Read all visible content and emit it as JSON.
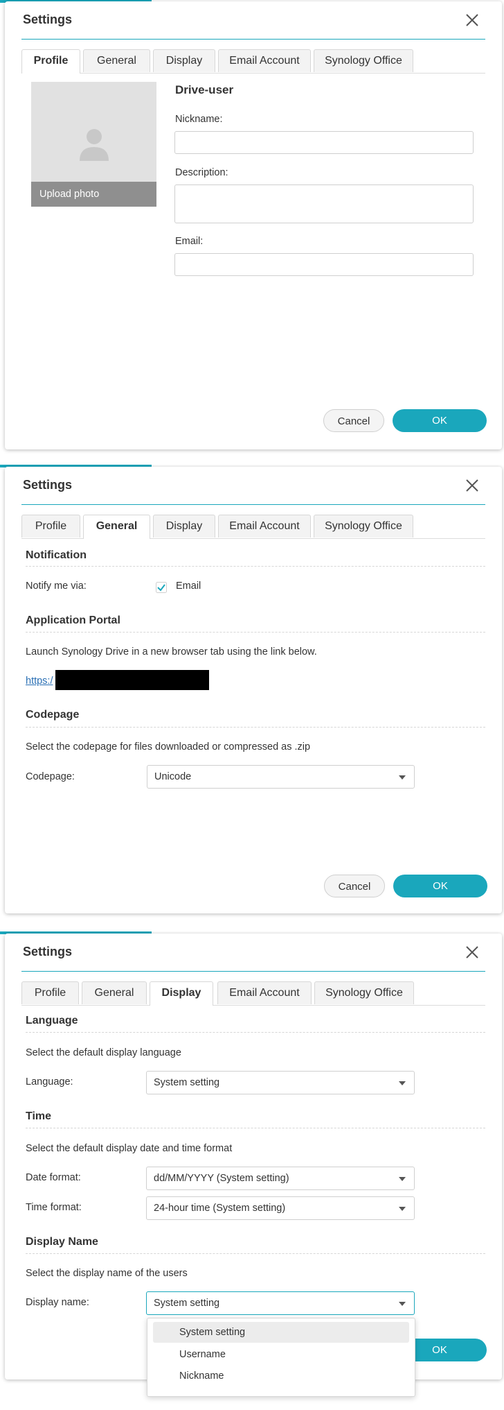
{
  "colors": {
    "accent": "#1aa7bc",
    "link": "#2a6fb4"
  },
  "panel1": {
    "title": "Settings",
    "tabs": [
      {
        "label": "Profile"
      },
      {
        "label": "General"
      },
      {
        "label": "Display"
      },
      {
        "label": "Email Account"
      },
      {
        "label": "Synology Office"
      }
    ],
    "active_tab": "Profile",
    "upload_photo": "Upload photo",
    "username": "Drive-user",
    "nickname_label": "Nickname:",
    "nickname_value": "",
    "description_label": "Description:",
    "description_value": "",
    "email_label": "Email:",
    "email_value": "",
    "cancel": "Cancel",
    "ok": "OK"
  },
  "panel2": {
    "title": "Settings",
    "tabs": [
      {
        "label": "Profile"
      },
      {
        "label": "General"
      },
      {
        "label": "Display"
      },
      {
        "label": "Email Account"
      },
      {
        "label": "Synology Office"
      }
    ],
    "active_tab": "General",
    "notification_title": "Notification",
    "notify_label": "Notify me via:",
    "email_option": "Email",
    "email_checked": true,
    "portal_title": "Application Portal",
    "portal_text": "Launch Synology Drive in a new browser tab using the link below.",
    "portal_link": "https:/",
    "codepage_title": "Codepage",
    "codepage_text": "Select the codepage for files downloaded or compressed as .zip",
    "codepage_label": "Codepage:",
    "codepage_value": "Unicode",
    "cancel": "Cancel",
    "ok": "OK"
  },
  "panel3": {
    "title": "Settings",
    "tabs": [
      {
        "label": "Profile"
      },
      {
        "label": "General"
      },
      {
        "label": "Display"
      },
      {
        "label": "Email Account"
      },
      {
        "label": "Synology Office"
      }
    ],
    "active_tab": "Display",
    "language_title": "Language",
    "language_text": "Select the default display language",
    "language_label": "Language:",
    "language_value": "System setting",
    "time_title": "Time",
    "time_text": "Select the default display date and time format",
    "date_format_label": "Date format:",
    "date_format_value": "dd/MM/YYYY (System setting)",
    "time_format_label": "Time format:",
    "time_format_value": "24-hour time (System setting)",
    "display_name_title": "Display Name",
    "display_name_text": "Select the display name of the users",
    "display_name_label": "Display name:",
    "display_name_value": "System setting",
    "display_name_options": [
      "System setting",
      "Username",
      "Nickname"
    ],
    "ok": "OK"
  }
}
